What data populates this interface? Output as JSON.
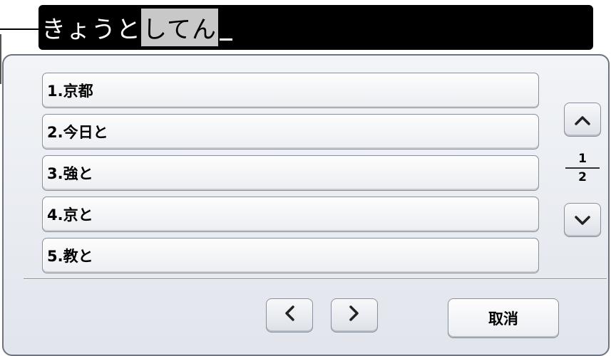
{
  "input": {
    "confirmed_text": "きょうと",
    "converting_text": "してん"
  },
  "candidates": [
    {
      "label": "1.京都"
    },
    {
      "label": "2.今日と"
    },
    {
      "label": "3.強と"
    },
    {
      "label": "4.京と"
    },
    {
      "label": "5.教と"
    }
  ],
  "pager": {
    "current": "1",
    "total": "2"
  },
  "buttons": {
    "cancel_label": "取消"
  },
  "icons": {
    "scroll_up": "chevron-up-icon",
    "scroll_down": "chevron-down-icon",
    "prev": "chevron-left-icon",
    "next": "chevron-right-icon"
  },
  "colors": {
    "input_background": "#000000",
    "converting_highlight": "#c8c8c8",
    "panel_background": "#e6e9ef"
  }
}
